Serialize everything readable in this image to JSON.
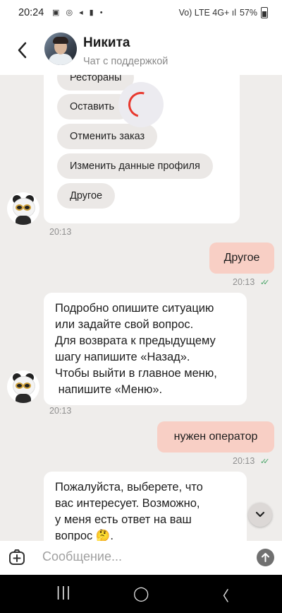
{
  "status_bar": {
    "time": "20:24",
    "left_icons": "▣ ◎ ◂ ▮ •",
    "signal": "Vo) LTE 4G+ ıl",
    "battery": "57%"
  },
  "header": {
    "back_icon": "chevron-left",
    "name": "Никита",
    "subtitle": "Чат с поддержкой"
  },
  "quick_replies": [
    "Рестораны",
    "Оставить",
    "Отменить заказ",
    "Изменить данные профиля",
    "Другое"
  ],
  "messages": {
    "bot1_time": "20:13",
    "user1_text": "Другое",
    "user1_time": "20:13",
    "bot2_lines": [
      "Подробно опишите ситуацию",
      "или задайте свой вопрос.",
      "Для возврата к предыдущему",
      "шагу напишите «Назад».",
      "Чтобы выйти в главное меню,",
      " напишите «Меню»."
    ],
    "bot2_time": "20:13",
    "user2_text": "нужен оператор",
    "user2_time": "20:13",
    "bot3_lines": [
      "Пожалуйста, выберете, что",
      "вас интересует. Возможно,",
      "у меня есть ответ на ваш",
      "вопрос 🤔."
    ]
  },
  "composer": {
    "placeholder": "Сообщение..."
  },
  "nav": {
    "recents": "|||",
    "home": "◯",
    "back": "〈"
  },
  "colors": {
    "user_bubble": "#f8cfc5",
    "spinner": "#e8382e",
    "read_ticks": "#46a365"
  }
}
